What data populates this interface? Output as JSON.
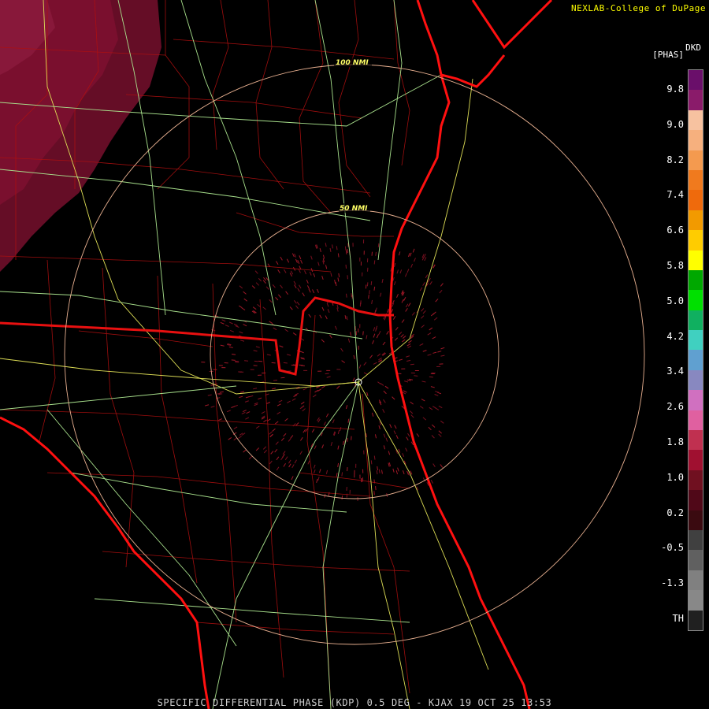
{
  "header": {
    "credit": "NEXLAB-College of DuPage",
    "product_code": "DKD",
    "units": "[PHAS]"
  },
  "map": {
    "range_rings": [
      {
        "label": "50 NMI"
      },
      {
        "label": "100 NMI"
      }
    ],
    "layers": [
      "state-borders",
      "county-borders",
      "coastline",
      "highways",
      "radar-returns"
    ]
  },
  "legend": {
    "labels": [
      "9.8",
      "9.0",
      "8.2",
      "7.4",
      "6.6",
      "5.8",
      "5.0",
      "4.2",
      "3.4",
      "2.6",
      "1.8",
      "1.0",
      "0.2",
      "-0.5",
      "-1.3",
      "TH"
    ],
    "colors": [
      "#6a0f6a",
      "#8a1b6a",
      "#f7c2a0",
      "#f6b07e",
      "#f49a4f",
      "#f07a1e",
      "#ef6a0c",
      "#f29a00",
      "#ffcc00",
      "#ffff00",
      "#00a800",
      "#00e000",
      "#10b060",
      "#40d0c0",
      "#60a0d0",
      "#8888c0",
      "#d070c0",
      "#e060a0",
      "#c03050",
      "#a01030",
      "#701020",
      "#500818",
      "#3a0a10",
      "#404040",
      "#606060",
      "#808080",
      "#888888",
      "#202020"
    ]
  },
  "footer": {
    "caption": "SPECIFIC DIFFERENTIAL PHASE (KDP) 0.5 DEG - KJAX 19 OCT 25 13:53"
  }
}
